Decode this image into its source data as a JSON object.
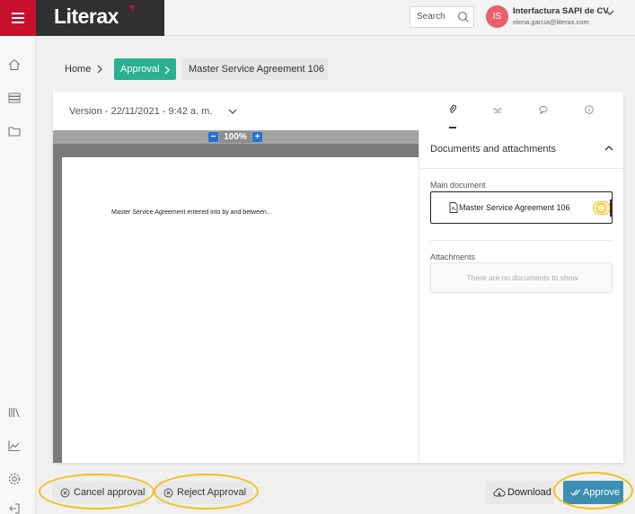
{
  "header": {
    "app_name": "Literax",
    "search_placeholder": "Search",
    "user_initials": "IS",
    "user_name": "Interfactura SAPI de CV",
    "user_email": "elena.garcia@literax.com",
    "brand_color": "#c8102e"
  },
  "breadcrumb": {
    "home": "Home",
    "approval": "Approval",
    "document": "Master Service Agreement 106"
  },
  "document_card": {
    "version_label": "Version - 22/11/2021 - 9:42 a. m.",
    "tabs": [
      "paperclip-icon",
      "signature-icon",
      "comments-icon",
      "info-icon"
    ],
    "active_tab": "paperclip-icon"
  },
  "viewer": {
    "zoom_minus": "−",
    "zoom_level": "100%",
    "zoom_plus": "+",
    "page_text": "Master Service Agreement entered into by and between..."
  },
  "panel": {
    "title": "Documents and attachments",
    "main_document_label": "Main document",
    "main_document_name": "Master Service Agreement 106",
    "attachments_label": "Attachments",
    "attachments_empty": "There are no documents to show"
  },
  "actions": {
    "cancel": "Cancel approval",
    "reject": "Reject Approval",
    "download": "Download",
    "approve": "Approve",
    "approve_color": "#3c8fb0"
  }
}
